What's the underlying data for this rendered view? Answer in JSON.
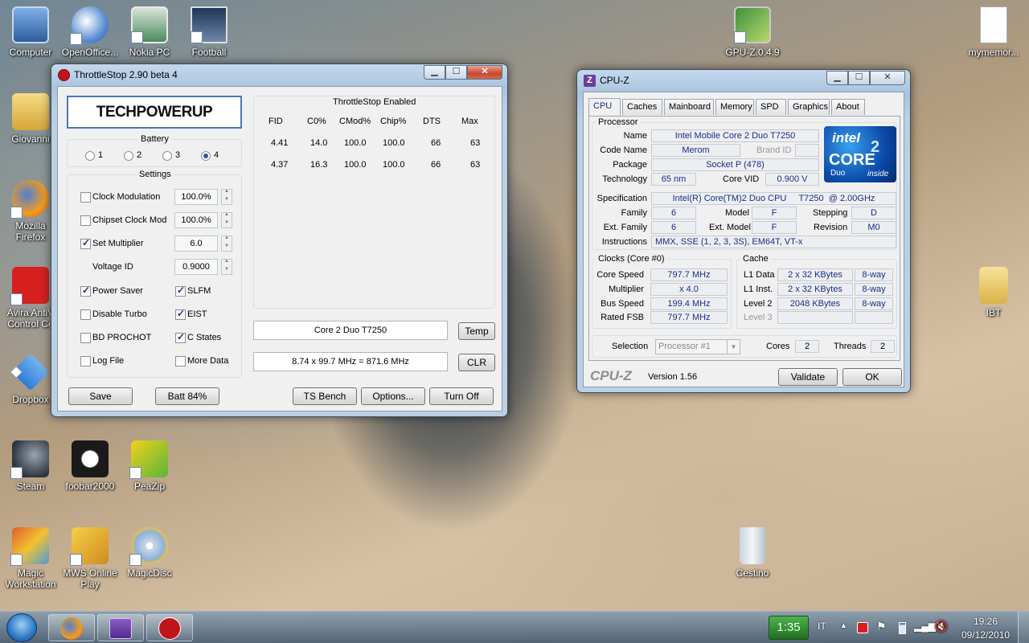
{
  "desktop": {
    "icons": [
      {
        "label": "Computer",
        "icon": "computer-icon"
      },
      {
        "label": "OpenOffice...",
        "icon": "openoffice-icon"
      },
      {
        "label": "Nokia PC",
        "icon": "nokia-pc-icon"
      },
      {
        "label": "Football",
        "icon": "football-icon"
      },
      {
        "label": "GPU-Z.0.4.9",
        "icon": "gpuz-icon"
      },
      {
        "label": "mymemor...",
        "icon": "document-icon"
      },
      {
        "label": "Giovanni",
        "icon": "user-folder-icon"
      },
      {
        "label": "Mozilla Firefox",
        "icon": "firefox-icon"
      },
      {
        "label": "Avira AntiV Control Ce",
        "icon": "avira-icon"
      },
      {
        "label": "Dropbox",
        "icon": "dropbox-icon"
      },
      {
        "label": "IBT",
        "icon": "folder-icon"
      },
      {
        "label": "Steam",
        "icon": "steam-icon"
      },
      {
        "label": "foobar2000",
        "icon": "foobar-icon"
      },
      {
        "label": "PeaZip",
        "icon": "peazip-icon"
      },
      {
        "label": "Magic Workstation",
        "icon": "magic-workstation-icon"
      },
      {
        "label": "MWS Online Play",
        "icon": "mws-online-icon"
      },
      {
        "label": "MagicDisc",
        "icon": "magicdisc-icon"
      },
      {
        "label": "Cestino",
        "icon": "recycle-bin-icon"
      }
    ]
  },
  "throttlestop": {
    "title": "ThrottleStop 2.90 beta 4",
    "logo": "TECHPOWERUP",
    "battery": {
      "title": "Battery",
      "options": [
        "1",
        "2",
        "3",
        "4"
      ],
      "selected": "4"
    },
    "settings": {
      "title": "Settings",
      "clock_modulation": {
        "label": "Clock Modulation",
        "value": "100.0%",
        "checked": false
      },
      "chipset_clock_mod": {
        "label": "Chipset Clock Mod",
        "value": "100.0%",
        "checked": false
      },
      "set_multiplier": {
        "label": "Set Multiplier",
        "value": "6.0",
        "checked": true
      },
      "voltage_id": {
        "label": "Voltage ID",
        "value": "0.9000"
      },
      "power_saver": {
        "label": "Power Saver",
        "checked": true
      },
      "slfm": {
        "label": "SLFM",
        "checked": true
      },
      "disable_turbo": {
        "label": "Disable Turbo",
        "checked": false
      },
      "eist": {
        "label": "EIST",
        "checked": true
      },
      "bd_prochot": {
        "label": "BD PROCHOT",
        "checked": false
      },
      "c_states": {
        "label": "C States",
        "checked": true
      },
      "log_file": {
        "label": "Log File",
        "checked": false
      },
      "more_data": {
        "label": "More Data",
        "checked": false
      }
    },
    "status": {
      "title": "ThrottleStop Enabled",
      "headers": [
        "FID",
        "C0%",
        "CMod%",
        "Chip%",
        "DTS",
        "Max"
      ],
      "rows": [
        [
          "4.41",
          "14.0",
          "100.0",
          "100.0",
          "66",
          "63"
        ],
        [
          "4.37",
          "16.3",
          "100.0",
          "100.0",
          "66",
          "63"
        ]
      ]
    },
    "cpu_name": "Core 2 Duo T7250",
    "frequency": "8.74 x 99.7 MHz = 871.6 MHz",
    "buttons": {
      "temp": "Temp",
      "clr": "CLR",
      "save": "Save",
      "batt": "Batt 84%",
      "ts_bench": "TS Bench",
      "options": "Options...",
      "turn_off": "Turn Off"
    }
  },
  "cpuz": {
    "title": "CPU-Z",
    "tabs": [
      "CPU",
      "Caches",
      "Mainboard",
      "Memory",
      "SPD",
      "Graphics",
      "About"
    ],
    "active_tab": "CPU",
    "processor": {
      "group": "Processor",
      "name_label": "Name",
      "name": "Intel Mobile Core 2 Duo T7250",
      "code_name_label": "Code Name",
      "code_name": "Merom",
      "brand_id_label": "Brand ID",
      "brand_id": "",
      "package_label": "Package",
      "package": "Socket P (478)",
      "technology_label": "Technology",
      "technology": "65 nm",
      "core_vid_label": "Core VID",
      "core_vid": "0.900 V",
      "specification_label": "Specification",
      "specification": "Intel(R) Core(TM)2 Duo CPU     T7250  @ 2.00GHz",
      "family_label": "Family",
      "family": "6",
      "model_label": "Model",
      "model": "F",
      "stepping_label": "Stepping",
      "stepping": "D",
      "ext_family_label": "Ext. Family",
      "ext_family": "6",
      "ext_model_label": "Ext. Model",
      "ext_model": "F",
      "revision_label": "Revision",
      "revision": "M0",
      "instructions_label": "Instructions",
      "instructions": "MMX, SSE (1, 2, 3, 3S), EM64T, VT-x",
      "logo_brand": "intel",
      "logo_core": "CORE",
      "logo_duo": "Duo",
      "logo_inside": "inside",
      "logo_2": "2"
    },
    "clocks": {
      "group": "Clocks (Core #0)",
      "core_speed_label": "Core Speed",
      "core_speed": "797.7 MHz",
      "multiplier_label": "Multiplier",
      "multiplier": "x 4.0",
      "bus_speed_label": "Bus Speed",
      "bus_speed": "199.4 MHz",
      "rated_fsb_label": "Rated FSB",
      "rated_fsb": "797.7 MHz"
    },
    "cache": {
      "group": "Cache",
      "l1_data_label": "L1 Data",
      "l1_data": "2 x 32 KBytes",
      "l1_data_way": "8-way",
      "l1_inst_label": "L1 Inst.",
      "l1_inst": "2 x 32 KBytes",
      "l1_inst_way": "8-way",
      "level2_label": "Level 2",
      "level2": "2048 KBytes",
      "level2_way": "8-way",
      "level3_label": "Level 3"
    },
    "selection_label": "Selection",
    "selection_value": "Processor #1",
    "cores_label": "Cores",
    "cores": "2",
    "threads_label": "Threads",
    "threads": "2",
    "footer_logo": "CPU-Z",
    "version": "Version 1.56",
    "validate": "Validate",
    "ok": "OK"
  },
  "taskbar": {
    "clock_gadget": "1:35",
    "language": "IT",
    "time": "19:26",
    "date": "09/12/2010"
  }
}
